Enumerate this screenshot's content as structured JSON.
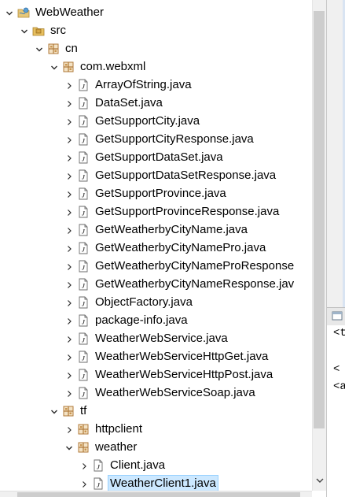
{
  "tree": {
    "items": [
      {
        "label": "WebWeather",
        "indent": 0,
        "expanded": true,
        "icon": "project-icon",
        "icon_name": "java-project-icon",
        "has_chevron": true
      },
      {
        "label": "src",
        "indent": 1,
        "expanded": true,
        "icon": "src-folder-icon",
        "icon_name": "source-folder-icon",
        "has_chevron": true
      },
      {
        "label": "cn",
        "indent": 2,
        "expanded": true,
        "icon": "package-icon",
        "icon_name": "package-icon",
        "has_chevron": true
      },
      {
        "label": "com.webxml",
        "indent": 3,
        "expanded": true,
        "icon": "package-icon",
        "icon_name": "package-icon",
        "has_chevron": true
      },
      {
        "label": "ArrayOfString.java",
        "indent": 4,
        "expanded": false,
        "icon": "java-file-icon",
        "icon_name": "java-file-icon",
        "has_chevron": true
      },
      {
        "label": "DataSet.java",
        "indent": 4,
        "expanded": false,
        "icon": "java-file-icon",
        "icon_name": "java-file-icon",
        "has_chevron": true
      },
      {
        "label": "GetSupportCity.java",
        "indent": 4,
        "expanded": false,
        "icon": "java-file-icon",
        "icon_name": "java-file-icon",
        "has_chevron": true
      },
      {
        "label": "GetSupportCityResponse.java",
        "indent": 4,
        "expanded": false,
        "icon": "java-file-icon",
        "icon_name": "java-file-icon",
        "has_chevron": true
      },
      {
        "label": "GetSupportDataSet.java",
        "indent": 4,
        "expanded": false,
        "icon": "java-file-icon",
        "icon_name": "java-file-icon",
        "has_chevron": true
      },
      {
        "label": "GetSupportDataSetResponse.java",
        "indent": 4,
        "expanded": false,
        "icon": "java-file-icon",
        "icon_name": "java-file-icon",
        "has_chevron": true
      },
      {
        "label": "GetSupportProvince.java",
        "indent": 4,
        "expanded": false,
        "icon": "java-file-icon",
        "icon_name": "java-file-icon",
        "has_chevron": true
      },
      {
        "label": "GetSupportProvinceResponse.java",
        "indent": 4,
        "expanded": false,
        "icon": "java-file-icon",
        "icon_name": "java-file-icon",
        "has_chevron": true
      },
      {
        "label": "GetWeatherbyCityName.java",
        "indent": 4,
        "expanded": false,
        "icon": "java-file-icon",
        "icon_name": "java-file-icon",
        "has_chevron": true
      },
      {
        "label": "GetWeatherbyCityNamePro.java",
        "indent": 4,
        "expanded": false,
        "icon": "java-file-icon",
        "icon_name": "java-file-icon",
        "has_chevron": true
      },
      {
        "label": "GetWeatherbyCityNameProResponse",
        "indent": 4,
        "expanded": false,
        "icon": "java-file-icon",
        "icon_name": "java-file-icon",
        "has_chevron": true
      },
      {
        "label": "GetWeatherbyCityNameResponse.jav",
        "indent": 4,
        "expanded": false,
        "icon": "java-file-icon",
        "icon_name": "java-file-icon",
        "has_chevron": true
      },
      {
        "label": "ObjectFactory.java",
        "indent": 4,
        "expanded": false,
        "icon": "java-file-icon",
        "icon_name": "java-file-icon",
        "has_chevron": true
      },
      {
        "label": "package-info.java",
        "indent": 4,
        "expanded": false,
        "icon": "java-file-icon",
        "icon_name": "java-file-icon",
        "has_chevron": true
      },
      {
        "label": "WeatherWebService.java",
        "indent": 4,
        "expanded": false,
        "icon": "java-file-icon",
        "icon_name": "java-file-icon",
        "has_chevron": true
      },
      {
        "label": "WeatherWebServiceHttpGet.java",
        "indent": 4,
        "expanded": false,
        "icon": "java-file-icon",
        "icon_name": "java-file-icon",
        "has_chevron": true
      },
      {
        "label": "WeatherWebServiceHttpPost.java",
        "indent": 4,
        "expanded": false,
        "icon": "java-file-icon",
        "icon_name": "java-file-icon",
        "has_chevron": true
      },
      {
        "label": "WeatherWebServiceSoap.java",
        "indent": 4,
        "expanded": false,
        "icon": "java-file-icon",
        "icon_name": "java-file-icon",
        "has_chevron": true
      },
      {
        "label": "tf",
        "indent": 3,
        "expanded": true,
        "icon": "package-icon",
        "icon_name": "package-icon",
        "has_chevron": true
      },
      {
        "label": "httpclient",
        "indent": 4,
        "expanded": false,
        "icon": "package-icon",
        "icon_name": "package-icon",
        "has_chevron": true
      },
      {
        "label": "weather",
        "indent": 4,
        "expanded": true,
        "icon": "package-icon",
        "icon_name": "package-icon",
        "has_chevron": true
      },
      {
        "label": "Client.java",
        "indent": 5,
        "expanded": false,
        "icon": "java-file-icon",
        "icon_name": "java-file-icon",
        "has_chevron": true
      },
      {
        "label": "WeatherClient1.java",
        "indent": 5,
        "expanded": false,
        "icon": "java-file-icon",
        "icon_name": "java-file-icon",
        "has_chevron": true,
        "selected": true
      }
    ]
  },
  "side_panel": {
    "text_lines": [
      "<t",
      "<",
      "<a"
    ]
  },
  "colors": {
    "selection": "#cce8ff",
    "package_brown": "#b07a3a",
    "scroll_thumb": "#cdcdcd"
  }
}
